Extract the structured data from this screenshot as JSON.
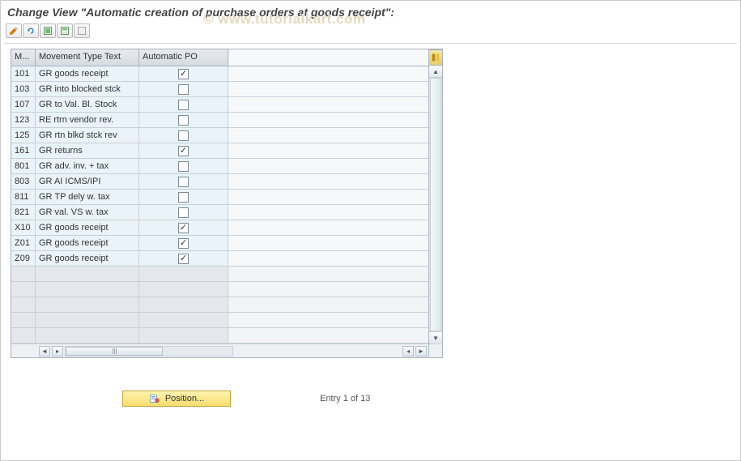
{
  "header": {
    "title": "Change View \"Automatic creation of purchase orders at goods receipt\":"
  },
  "watermark": "© www.tutorialkart.com",
  "toolbar": {
    "items": [
      {
        "name": "change-icon",
        "glyph": "pencil"
      },
      {
        "name": "undo-icon",
        "glyph": "undo"
      },
      {
        "name": "select-all-icon",
        "glyph": "select-all"
      },
      {
        "name": "select-block-icon",
        "glyph": "select-block"
      },
      {
        "name": "deselect-all-icon",
        "glyph": "deselect-all"
      }
    ]
  },
  "grid": {
    "columns": {
      "movement_type": "M...",
      "movement_text": "Movement Type Text",
      "auto_po": "Automatic PO"
    },
    "rows": [
      {
        "mt": "101",
        "txt": "GR goods receipt",
        "auto": true
      },
      {
        "mt": "103",
        "txt": "GR into blocked stck",
        "auto": false
      },
      {
        "mt": "107",
        "txt": "GR to Val. Bl. Stock",
        "auto": false
      },
      {
        "mt": "123",
        "txt": "RE rtrn vendor rev.",
        "auto": false
      },
      {
        "mt": "125",
        "txt": "GR rtn blkd stck rev",
        "auto": false
      },
      {
        "mt": "161",
        "txt": "GR returns",
        "auto": true
      },
      {
        "mt": "801",
        "txt": "GR adv. inv. + tax",
        "auto": false
      },
      {
        "mt": "803",
        "txt": "GR AI ICMS/IPI",
        "auto": false
      },
      {
        "mt": "811",
        "txt": "GR TP dely w. tax",
        "auto": false
      },
      {
        "mt": "821",
        "txt": "GR val. VS w. tax",
        "auto": false
      },
      {
        "mt": "X10",
        "txt": "GR goods receipt",
        "auto": true
      },
      {
        "mt": "Z01",
        "txt": "GR goods receipt",
        "auto": true
      },
      {
        "mt": "Z09",
        "txt": "GR goods receipt",
        "auto": true
      }
    ],
    "empty_rows": 5
  },
  "footer": {
    "position_label": "Position...",
    "entry_text": "Entry 1 of 13"
  }
}
